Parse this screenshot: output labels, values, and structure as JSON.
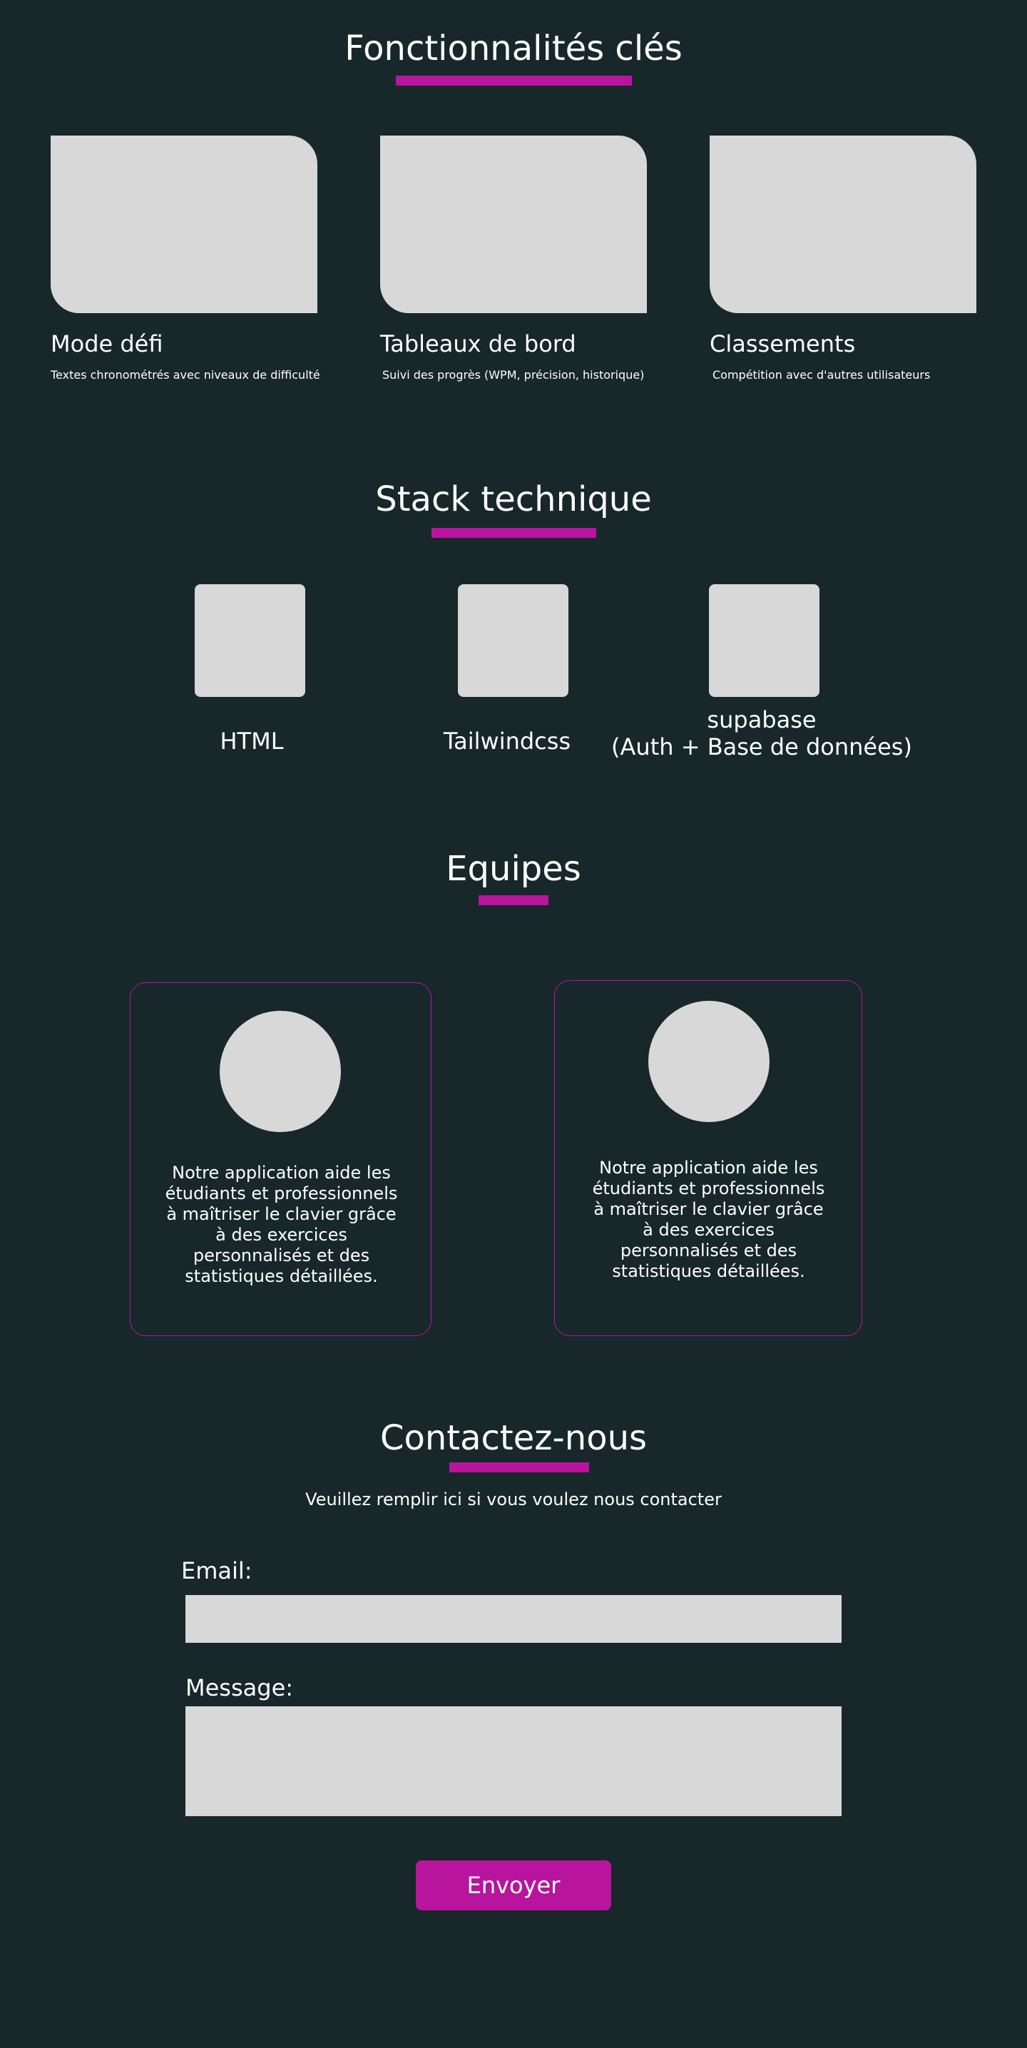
{
  "colors": {
    "background": "#17272a",
    "accent": "#b8149e",
    "placeholder": "#d8d8d8",
    "text": "#ffffff"
  },
  "features": {
    "title": "Fonctionnalités clés",
    "items": [
      {
        "title": "Mode défi",
        "desc": "Textes chronométrés avec niveaux de difficulté"
      },
      {
        "title": "Tableaux de bord",
        "desc": "Suivi des progrès (WPM, précision, historique)"
      },
      {
        "title": "Classements",
        "desc": "Compétition avec d'autres utilisateurs"
      }
    ]
  },
  "stack": {
    "title": "Stack technique",
    "items": [
      {
        "label": "HTML"
      },
      {
        "label": "Tailwindcss"
      },
      {
        "label": "supabase",
        "sublabel": "(Auth + Base de données)"
      }
    ]
  },
  "team": {
    "title": "Equipes",
    "members": [
      {
        "text": "Notre application aide les étudiants et professionnels à maîtriser le clavier grâce à des exercices personnalisés et des statistiques détaillées."
      },
      {
        "text": "Notre application aide les étudiants et professionnels à maîtriser le clavier grâce à des exercices personnalisés et des statistiques détaillées."
      }
    ]
  },
  "contact": {
    "title": "Contactez-nous",
    "subtitle": "Veuillez remplir ici si vous voulez nous contacter",
    "email_label": "Email:",
    "email_value": "",
    "message_label": "Message:",
    "message_value": "",
    "submit_label": "Envoyer"
  }
}
